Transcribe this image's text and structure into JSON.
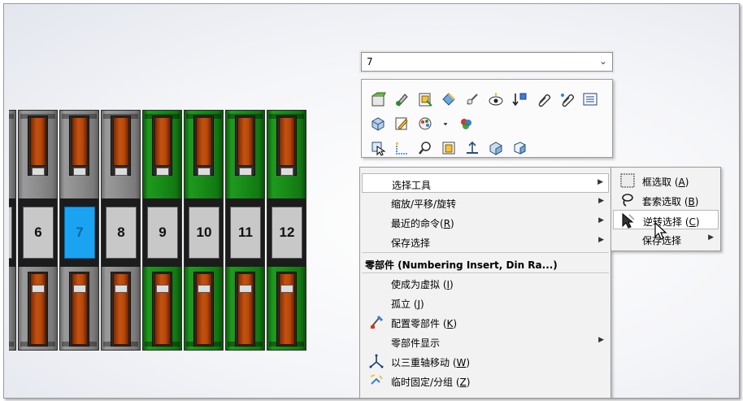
{
  "selection_dropdown": {
    "value": "7"
  },
  "assembly": {
    "modules": [
      {
        "label": "",
        "color": "gray"
      },
      {
        "label": "6",
        "color": "gray"
      },
      {
        "label": "7",
        "color": "gray",
        "selected": true
      },
      {
        "label": "8",
        "color": "gray"
      },
      {
        "label": "9",
        "color": "green"
      },
      {
        "label": "10",
        "color": "green"
      },
      {
        "label": "11",
        "color": "green"
      },
      {
        "label": "12",
        "color": "green"
      }
    ]
  },
  "toolbar": {
    "rows": [
      [
        "open-part-icon",
        "edit-feature-icon",
        "open-drawing-icon",
        "appearance-icon",
        "hide-show-icon",
        "view-icon",
        "insert-icon",
        "attachment-icon",
        "comment-icon",
        "list-icon"
      ],
      [
        "component-properties-icon",
        "edit-sketch-icon",
        "color-palette-icon",
        "dropdown-arrow-icon",
        "appearance-multi-icon"
      ],
      [
        "select-other-icon",
        "sketch-plane-icon",
        "zoom-selection-icon",
        "view-orientation-icon",
        "normal-to-icon",
        "isometric-view-icon",
        "section-view-icon"
      ]
    ]
  },
  "context_menu": {
    "items": [
      {
        "label": "选择工具",
        "submenu": true,
        "highlight": true
      },
      {
        "label": "缩放/平移/旋转",
        "submenu": true
      },
      {
        "label": "最近的命令(",
        "key": "R",
        "suffix": ")",
        "submenu": true
      },
      {
        "label": "保存选择",
        "submenu": true
      },
      {
        "label": "零部件 (Numbering Insert, Din Ra...)",
        "header": true
      },
      {
        "label": "使成为虚拟 (",
        "key": "I",
        "suffix": ")"
      },
      {
        "label": "孤立 (",
        "key": "J",
        "suffix": ")"
      },
      {
        "label": "配置零部件 (",
        "key": "K",
        "suffix": ")",
        "icon": "configure-component-icon"
      },
      {
        "label": "零部件显示",
        "submenu": true
      },
      {
        "label": "以三重轴移动 (",
        "key": "W",
        "suffix": ")",
        "icon": "triad-move-icon"
      },
      {
        "label": "临时固定/分组 (",
        "key": "Z",
        "suffix": ")",
        "icon": "temp-fix-icon"
      }
    ]
  },
  "submenu": {
    "items": [
      {
        "label": "框选取 (",
        "key": "A",
        "suffix": ")",
        "icon": "box-select-icon"
      },
      {
        "label": "套索选取 (",
        "key": "B",
        "suffix": ")",
        "icon": "lasso-select-icon"
      },
      {
        "label": "逆转选择 (",
        "key": "C",
        "suffix": ")",
        "icon": "invert-selection-icon",
        "highlight": true
      },
      {
        "label": "保存选择",
        "submenu": true
      }
    ]
  },
  "colors": {
    "gray_module": "#8c8c8c",
    "green_module": "#178a17",
    "selected_label": "#1aa3f0",
    "lever": "#c4520f"
  }
}
